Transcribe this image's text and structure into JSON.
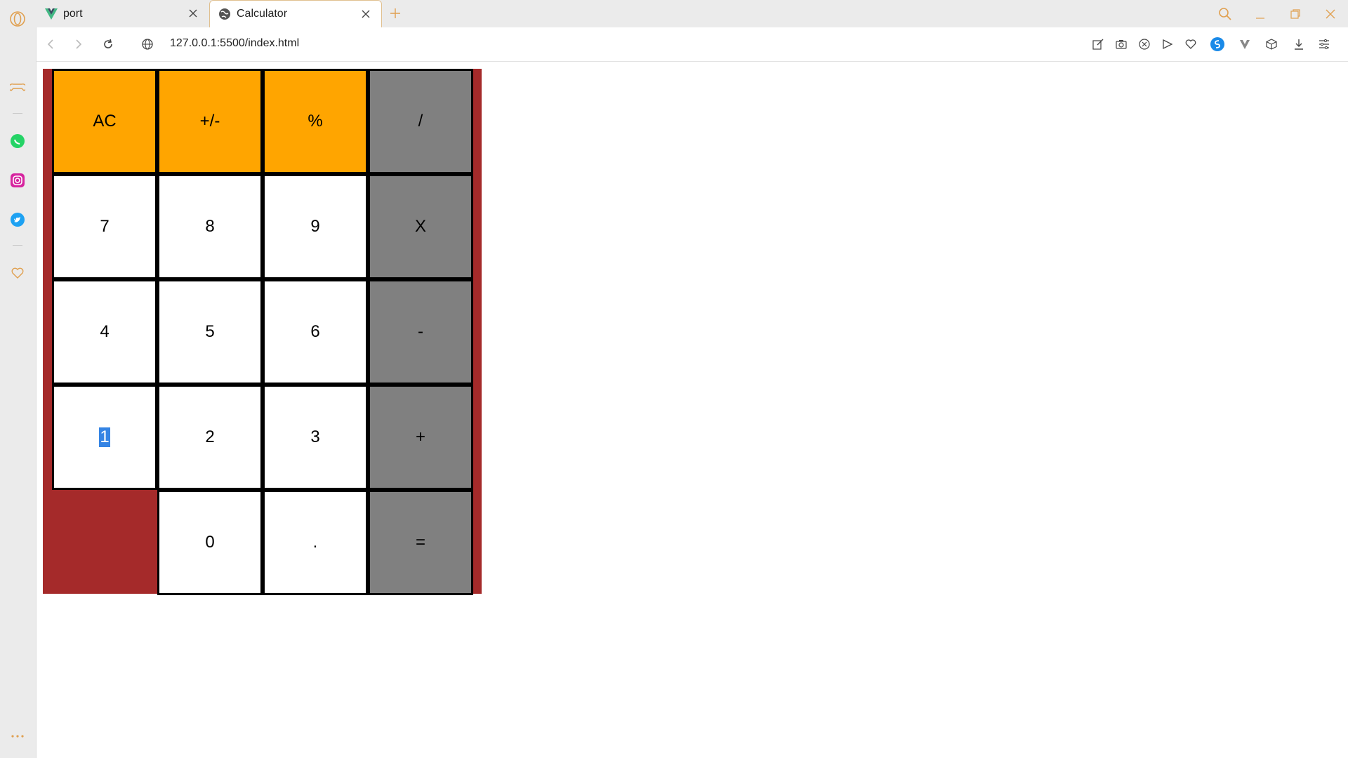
{
  "browser": {
    "tabs": [
      {
        "title": "port",
        "active": false,
        "favicon": "vue-icon"
      },
      {
        "title": "Calculator",
        "active": true,
        "favicon": "globe-icon"
      }
    ],
    "url": "127.0.0.1:5500/index.html",
    "accent_color": "#e0a050"
  },
  "calculator": {
    "rows": [
      [
        {
          "label": "AC",
          "style": "orange"
        },
        {
          "label": "+/-",
          "style": "orange"
        },
        {
          "label": "%",
          "style": "orange"
        },
        {
          "label": "/",
          "style": "gray"
        }
      ],
      [
        {
          "label": "7",
          "style": "white"
        },
        {
          "label": "8",
          "style": "white"
        },
        {
          "label": "9",
          "style": "white"
        },
        {
          "label": "X",
          "style": "gray"
        }
      ],
      [
        {
          "label": "4",
          "style": "white"
        },
        {
          "label": "5",
          "style": "white"
        },
        {
          "label": "6",
          "style": "white"
        },
        {
          "label": "-",
          "style": "gray"
        }
      ],
      [
        {
          "label": "1",
          "style": "white",
          "selected": true
        },
        {
          "label": "2",
          "style": "white"
        },
        {
          "label": "3",
          "style": "white"
        },
        {
          "label": "+",
          "style": "gray"
        }
      ],
      [
        {
          "label": "",
          "style": "blank"
        },
        {
          "label": "0",
          "style": "white"
        },
        {
          "label": ".",
          "style": "white"
        },
        {
          "label": "=",
          "style": "gray"
        }
      ]
    ],
    "colors": {
      "background": "#a52a2a",
      "function_keys": "#ffa500",
      "digit_keys": "#ffffff",
      "operator_keys": "#808080"
    }
  }
}
